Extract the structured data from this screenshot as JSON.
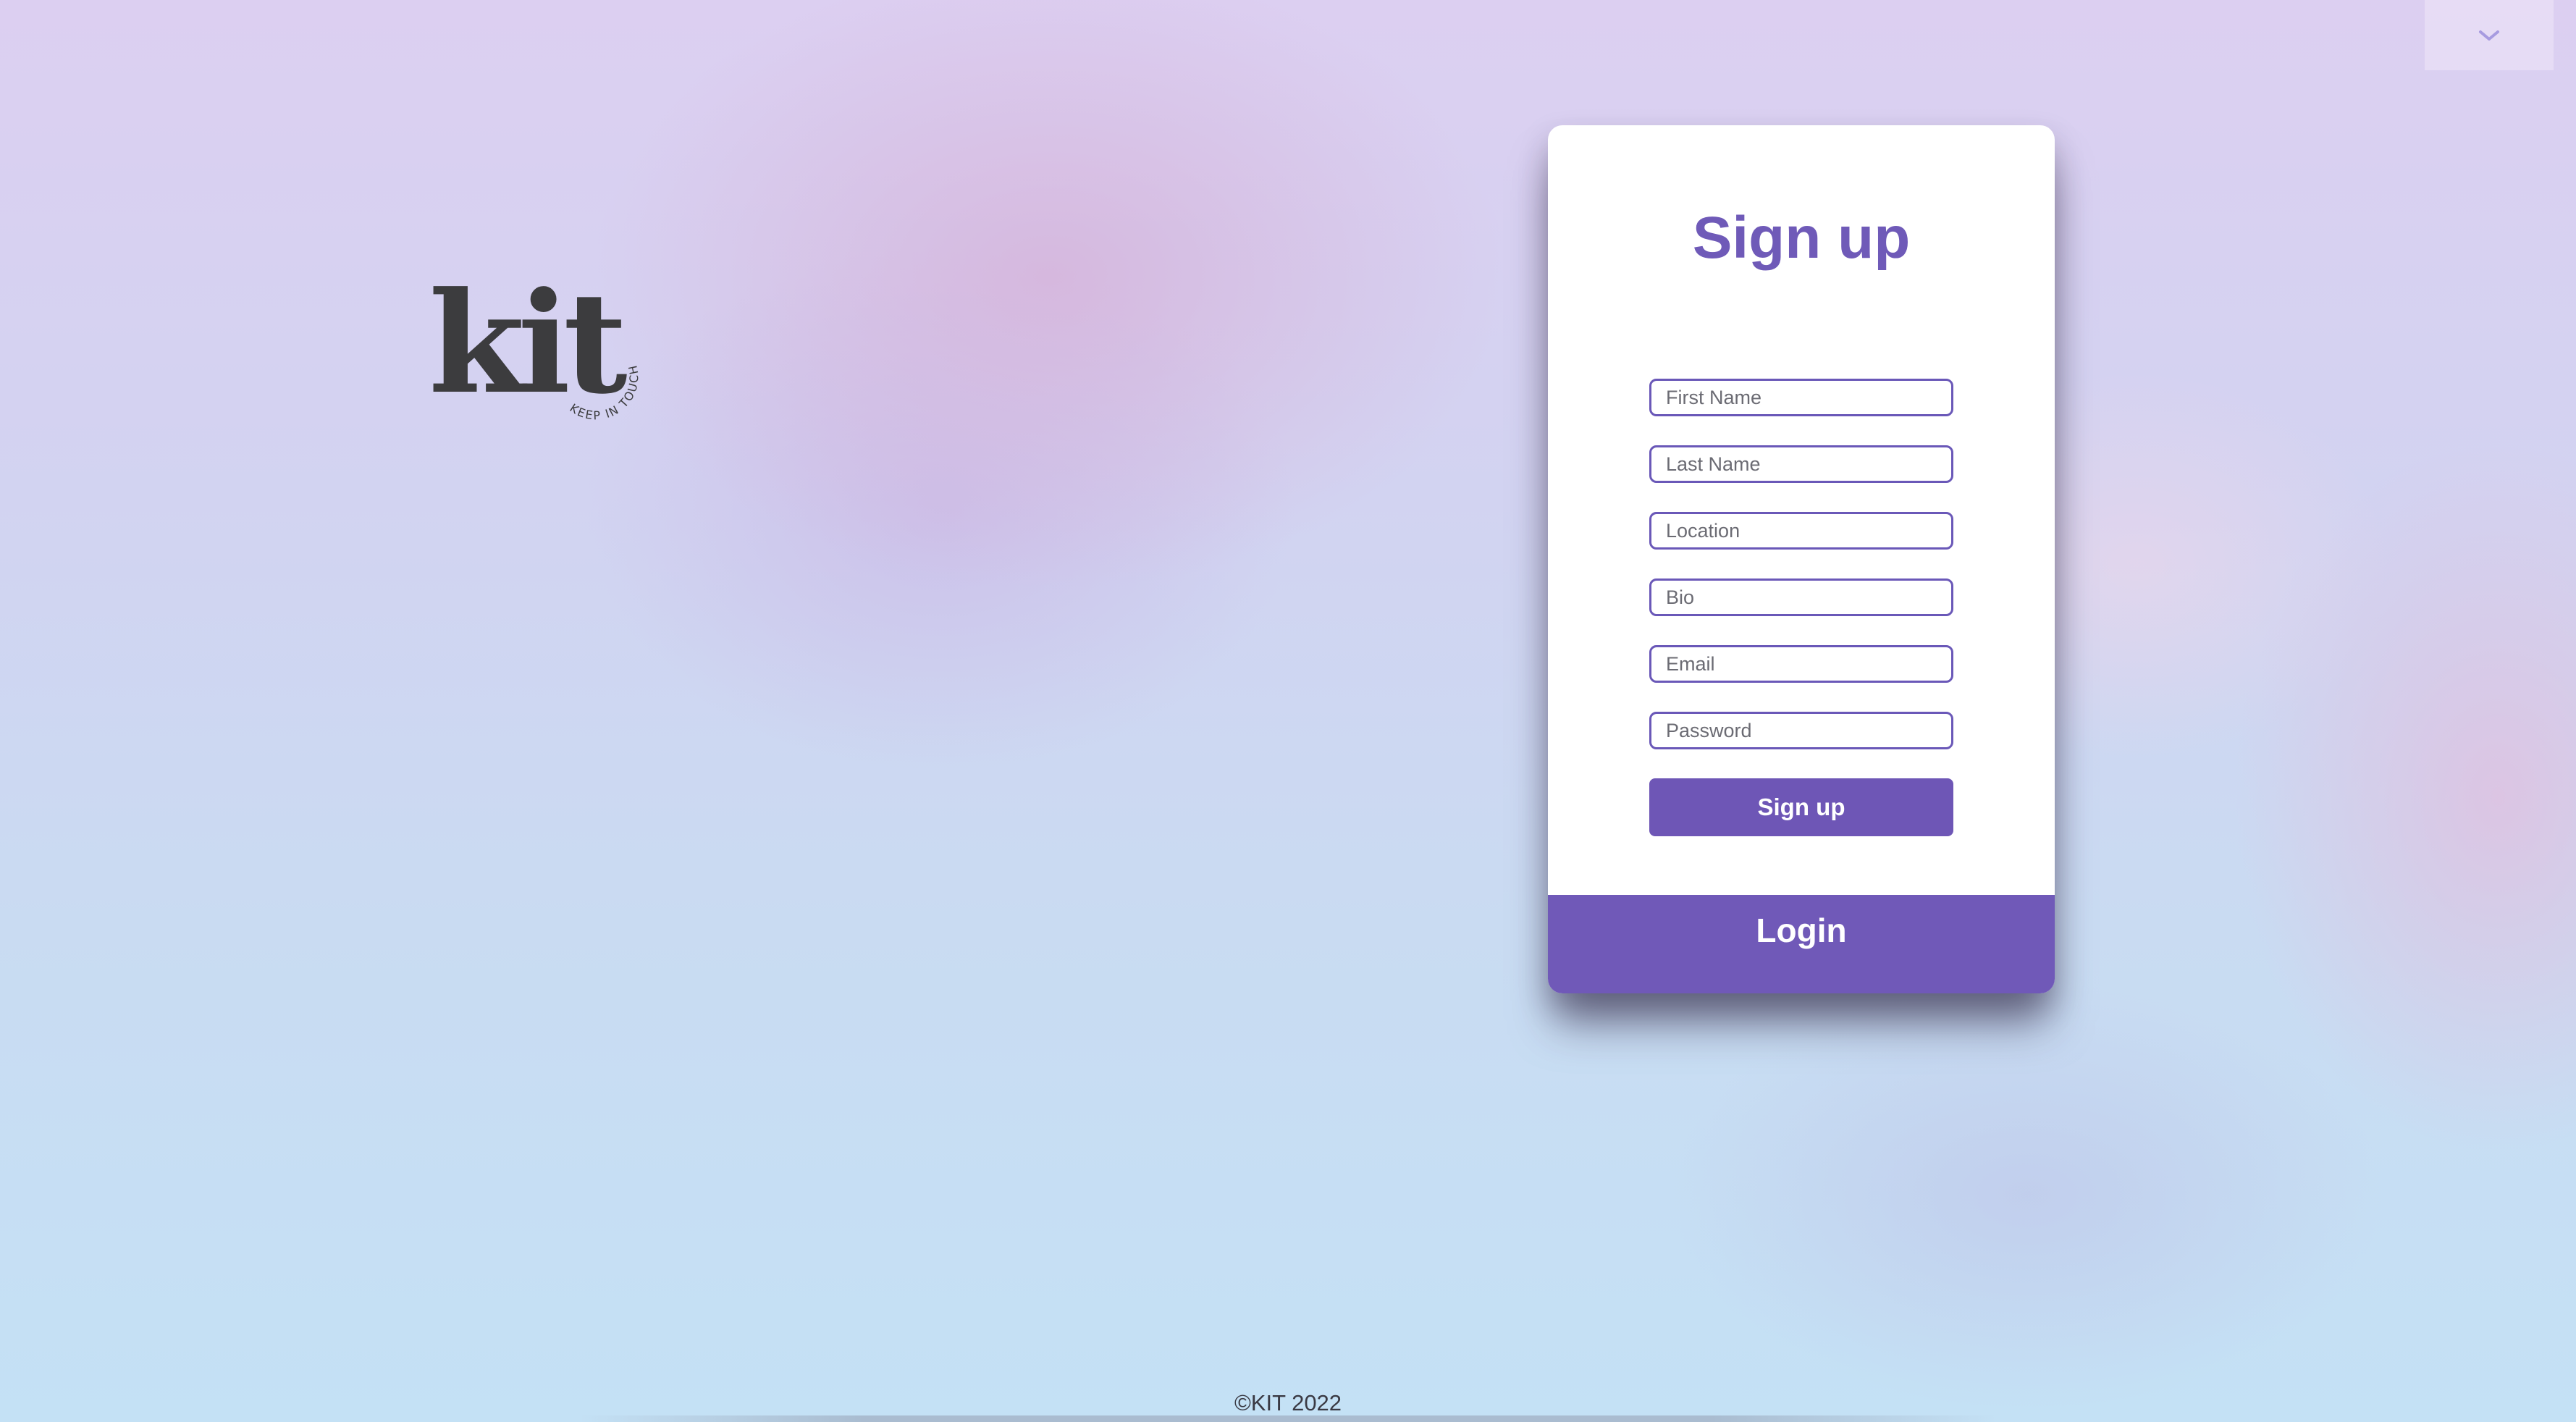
{
  "brand": {
    "logo_text": "kit",
    "tagline": "KEEP IN TOUCH"
  },
  "header": {
    "toggle_icon": "chevron-down-icon"
  },
  "signup_form": {
    "title": "Sign up",
    "fields": {
      "first_name": {
        "placeholder": "First Name",
        "value": ""
      },
      "last_name": {
        "placeholder": "Last Name",
        "value": ""
      },
      "location": {
        "placeholder": "Location",
        "value": ""
      },
      "bio": {
        "placeholder": "Bio",
        "value": ""
      },
      "email": {
        "placeholder": "Email",
        "value": ""
      },
      "password": {
        "placeholder": "Password",
        "value": ""
      }
    },
    "submit_label": "Sign up",
    "login_label": "Login"
  },
  "footer": {
    "copyright": "©KIT 2022"
  },
  "colors": {
    "accent": "#6e56b6",
    "logo": "#3c3c3e"
  }
}
